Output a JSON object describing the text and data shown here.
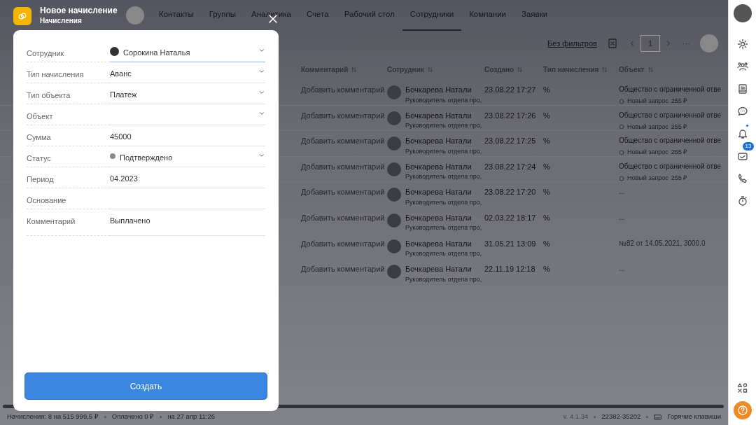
{
  "app_tabs": [
    {
      "label": "Контакты",
      "selected": false
    },
    {
      "label": "Группы",
      "selected": false
    },
    {
      "label": "Аналитика",
      "selected": false
    },
    {
      "label": "Счета",
      "selected": false
    },
    {
      "label": "Рабочий стол",
      "selected": false
    },
    {
      "label": "Сотрудники",
      "selected": true
    },
    {
      "label": "Компании",
      "selected": false
    },
    {
      "label": "Заявки",
      "selected": false
    }
  ],
  "toolbar": {
    "filter_link": "Без фильтров",
    "page": "1",
    "more": "···"
  },
  "table": {
    "columns": [
      "Комментарий",
      "Сотрудник",
      "Создано",
      "Тип начисления",
      "Объект"
    ],
    "rows": [
      {
        "comment": "Добавить комментарий",
        "employee": "Бочкарева Натали",
        "position": "Руководитель отдела про,",
        "created": "23.08.22 17:27",
        "accrual_type": "%",
        "object": "Общество с ограниченной отве",
        "object_status": "Новый запрос",
        "object_amount": "255 ₽"
      },
      {
        "comment": "Добавить комментарий",
        "employee": "Бочкарева Натали",
        "position": "Руководитель отдела про,",
        "created": "23.08.22 17:26",
        "accrual_type": "%",
        "object": "Общество с ограниченной отве",
        "object_status": "Новый запрос",
        "object_amount": "255 ₽"
      },
      {
        "comment": "Добавить комментарий",
        "employee": "Бочкарева Натали",
        "position": "Руководитель отдела про,",
        "created": "23.08.22 17:25",
        "accrual_type": "%",
        "object": "Общество с ограниченной отве",
        "object_status": "Новый запрос",
        "object_amount": "255 ₽"
      },
      {
        "comment": "Добавить комментарий",
        "employee": "Бочкарева Натали",
        "position": "Руководитель отдела про,",
        "created": "23.08.22 17:24",
        "accrual_type": "%",
        "object": "Общество с ограниченной отве",
        "object_status": "Новый запрос",
        "object_amount": "255 ₽"
      },
      {
        "comment": "Добавить комментарий",
        "employee": "Бочкарева Натали",
        "position": "Руководитель отдела про,",
        "created": "23.08.22 17:20",
        "accrual_type": "%",
        "object": "..."
      },
      {
        "comment": "Добавить комментарий",
        "employee": "Бочкарева Натали",
        "position": "Руководитель отдела про,",
        "created": "02.03.22 18:17",
        "accrual_type": "%",
        "object": "..."
      },
      {
        "comment": "Добавить комментарий",
        "employee": "Бочкарева Натали",
        "position": "Руководитель отдела про,",
        "created": "31.05.21 13:09",
        "accrual_type": "%",
        "object": "№82 от 14.05.2021, 3000.0"
      },
      {
        "comment": "Добавить комментарий",
        "employee": "Бочкарева Натали",
        "position": "Руководитель отдела про,",
        "created": "22.11.19 12:18",
        "accrual_type": "%",
        "object": "..."
      }
    ]
  },
  "status_bar": {
    "accruals": "Начисления: 8 на 515 999,5 ₽",
    "paid": "Оплачено 0 ₽",
    "date": "на 27 апр 11:26",
    "version": "v. 4.1.34",
    "build": "22382-35202",
    "hotkeys": "Горячие клавиши"
  },
  "sidebar": {
    "notifications_unread": true,
    "messages_badge": "13"
  },
  "modal": {
    "title": "Новое начисление",
    "subtitle": "Начисления",
    "fields": [
      {
        "label": "Сотрудник",
        "kind": "employee",
        "value": "Сорокина Наталья",
        "focused": true
      },
      {
        "label": "Тип начисления",
        "kind": "select",
        "value": "Аванс"
      },
      {
        "label": "Тип объекта",
        "kind": "select",
        "value": "Платеж"
      },
      {
        "label": "Объект",
        "kind": "select"
      },
      {
        "label": "Сумма",
        "kind": "input",
        "value": "45000"
      },
      {
        "label": "Статус",
        "kind": "status",
        "value": "Подтверждено",
        "color": "#8a8a8a"
      },
      {
        "label": "Период",
        "kind": "input",
        "value": "04.2023"
      },
      {
        "label": "Основание",
        "kind": "input"
      },
      {
        "label": "Комментарий",
        "kind": "textarea",
        "value": "Выплачено"
      }
    ],
    "submit": "Создать"
  }
}
